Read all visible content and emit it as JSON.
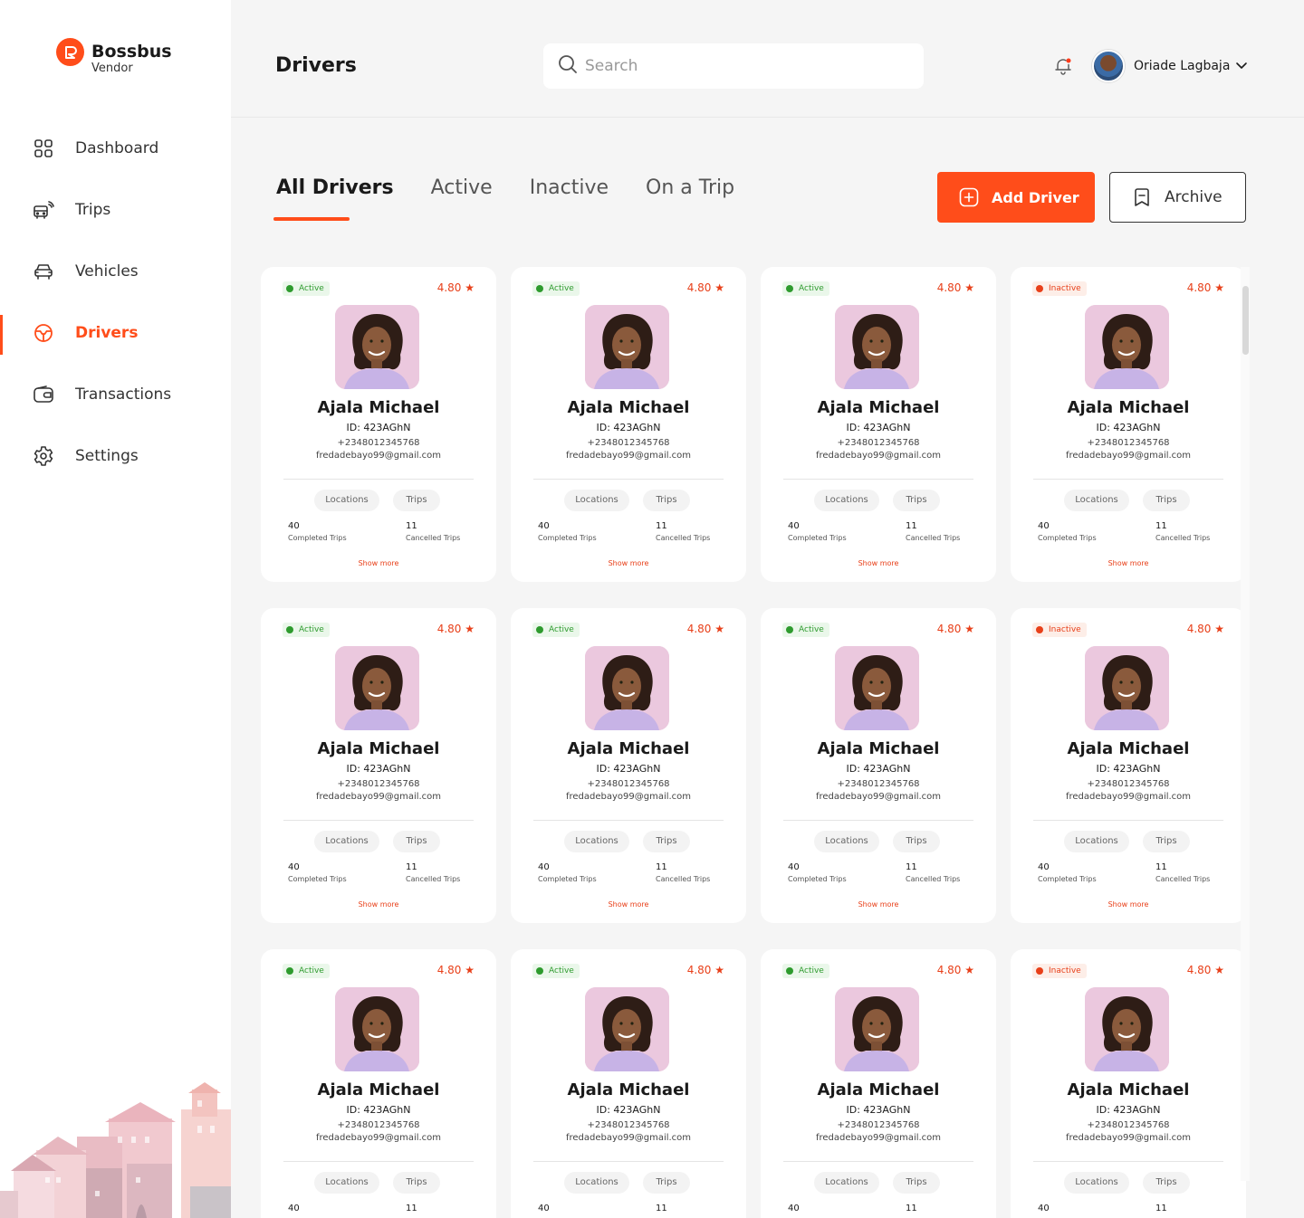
{
  "app": {
    "name": "Bossbus",
    "subtitle": "Vendor"
  },
  "sidebar": {
    "items": [
      {
        "label": "Dashboard",
        "icon": "grid-icon",
        "active": false
      },
      {
        "label": "Trips",
        "icon": "bus-signal-icon",
        "active": false
      },
      {
        "label": "Vehicles",
        "icon": "car-icon",
        "active": false
      },
      {
        "label": "Drivers",
        "icon": "steering-wheel-icon",
        "active": true
      },
      {
        "label": "Transactions",
        "icon": "wallet-icon",
        "active": false
      },
      {
        "label": "Settings",
        "icon": "gear-icon",
        "active": false
      }
    ]
  },
  "header": {
    "title": "Drivers",
    "search_placeholder": "Search",
    "user_name": "Oriade Lagbaja"
  },
  "tabs": [
    {
      "label": "All Drivers",
      "active": true
    },
    {
      "label": "Active",
      "active": false
    },
    {
      "label": "Inactive",
      "active": false
    },
    {
      "label": "On a Trip",
      "active": false
    }
  ],
  "actions": {
    "add_label": "Add Driver",
    "archive_label": "Archive"
  },
  "colors": {
    "accent": "#ff4d1a",
    "active_status": "#2e9b2e",
    "inactive_status": "#e8401a"
  },
  "drivers": [
    {
      "status": "Active",
      "rating": "4.80",
      "name": "Ajala Michael",
      "id": "ID: 423AGhN",
      "phone": "+2348012345768",
      "email": "fredadebayo99@gmail.com",
      "locations_label": "Locations",
      "trips_label": "Trips",
      "completed": "40",
      "completed_label": "Completed Trips",
      "cancelled": "11",
      "cancelled_label": "Cancelled Trips",
      "more": "Show more"
    },
    {
      "status": "Active",
      "rating": "4.80",
      "name": "Ajala Michael",
      "id": "ID: 423AGhN",
      "phone": "+2348012345768",
      "email": "fredadebayo99@gmail.com",
      "locations_label": "Locations",
      "trips_label": "Trips",
      "completed": "40",
      "completed_label": "Completed Trips",
      "cancelled": "11",
      "cancelled_label": "Cancelled Trips",
      "more": "Show more"
    },
    {
      "status": "Active",
      "rating": "4.80",
      "name": "Ajala Michael",
      "id": "ID: 423AGhN",
      "phone": "+2348012345768",
      "email": "fredadebayo99@gmail.com",
      "locations_label": "Locations",
      "trips_label": "Trips",
      "completed": "40",
      "completed_label": "Completed Trips",
      "cancelled": "11",
      "cancelled_label": "Cancelled Trips",
      "more": "Show more"
    },
    {
      "status": "Inactive",
      "rating": "4.80",
      "name": "Ajala Michael",
      "id": "ID: 423AGhN",
      "phone": "+2348012345768",
      "email": "fredadebayo99@gmail.com",
      "locations_label": "Locations",
      "trips_label": "Trips",
      "completed": "40",
      "completed_label": "Completed Trips",
      "cancelled": "11",
      "cancelled_label": "Cancelled Trips",
      "more": "Show more"
    },
    {
      "status": "Active",
      "rating": "4.80",
      "name": "Ajala Michael",
      "id": "ID: 423AGhN",
      "phone": "+2348012345768",
      "email": "fredadebayo99@gmail.com",
      "locations_label": "Locations",
      "trips_label": "Trips",
      "completed": "40",
      "completed_label": "Completed Trips",
      "cancelled": "11",
      "cancelled_label": "Cancelled Trips",
      "more": "Show more"
    },
    {
      "status": "Active",
      "rating": "4.80",
      "name": "Ajala Michael",
      "id": "ID: 423AGhN",
      "phone": "+2348012345768",
      "email": "fredadebayo99@gmail.com",
      "locations_label": "Locations",
      "trips_label": "Trips",
      "completed": "40",
      "completed_label": "Completed Trips",
      "cancelled": "11",
      "cancelled_label": "Cancelled Trips",
      "more": "Show more"
    },
    {
      "status": "Active",
      "rating": "4.80",
      "name": "Ajala Michael",
      "id": "ID: 423AGhN",
      "phone": "+2348012345768",
      "email": "fredadebayo99@gmail.com",
      "locations_label": "Locations",
      "trips_label": "Trips",
      "completed": "40",
      "completed_label": "Completed Trips",
      "cancelled": "11",
      "cancelled_label": "Cancelled Trips",
      "more": "Show more"
    },
    {
      "status": "Inactive",
      "rating": "4.80",
      "name": "Ajala Michael",
      "id": "ID: 423AGhN",
      "phone": "+2348012345768",
      "email": "fredadebayo99@gmail.com",
      "locations_label": "Locations",
      "trips_label": "Trips",
      "completed": "40",
      "completed_label": "Completed Trips",
      "cancelled": "11",
      "cancelled_label": "Cancelled Trips",
      "more": "Show more"
    },
    {
      "status": "Active",
      "rating": "4.80",
      "name": "Ajala Michael",
      "id": "ID: 423AGhN",
      "phone": "+2348012345768",
      "email": "fredadebayo99@gmail.com",
      "locations_label": "Locations",
      "trips_label": "Trips",
      "completed": "40",
      "completed_label": "",
      "cancelled": "11",
      "cancelled_label": "",
      "more": ""
    },
    {
      "status": "Active",
      "rating": "4.80",
      "name": "Ajala Michael",
      "id": "ID: 423AGhN",
      "phone": "+2348012345768",
      "email": "fredadebayo99@gmail.com",
      "locations_label": "Locations",
      "trips_label": "Trips",
      "completed": "40",
      "completed_label": "",
      "cancelled": "11",
      "cancelled_label": "",
      "more": ""
    },
    {
      "status": "Active",
      "rating": "4.80",
      "name": "Ajala Michael",
      "id": "ID: 423AGhN",
      "phone": "+2348012345768",
      "email": "fredadebayo99@gmail.com",
      "locations_label": "Locations",
      "trips_label": "Trips",
      "completed": "40",
      "completed_label": "",
      "cancelled": "11",
      "cancelled_label": "",
      "more": ""
    },
    {
      "status": "Inactive",
      "rating": "4.80",
      "name": "Ajala Michael",
      "id": "ID: 423AGhN",
      "phone": "+2348012345768",
      "email": "fredadebayo99@gmail.com",
      "locations_label": "Locations",
      "trips_label": "Trips",
      "completed": "40",
      "completed_label": "",
      "cancelled": "11",
      "cancelled_label": "",
      "more": ""
    }
  ]
}
